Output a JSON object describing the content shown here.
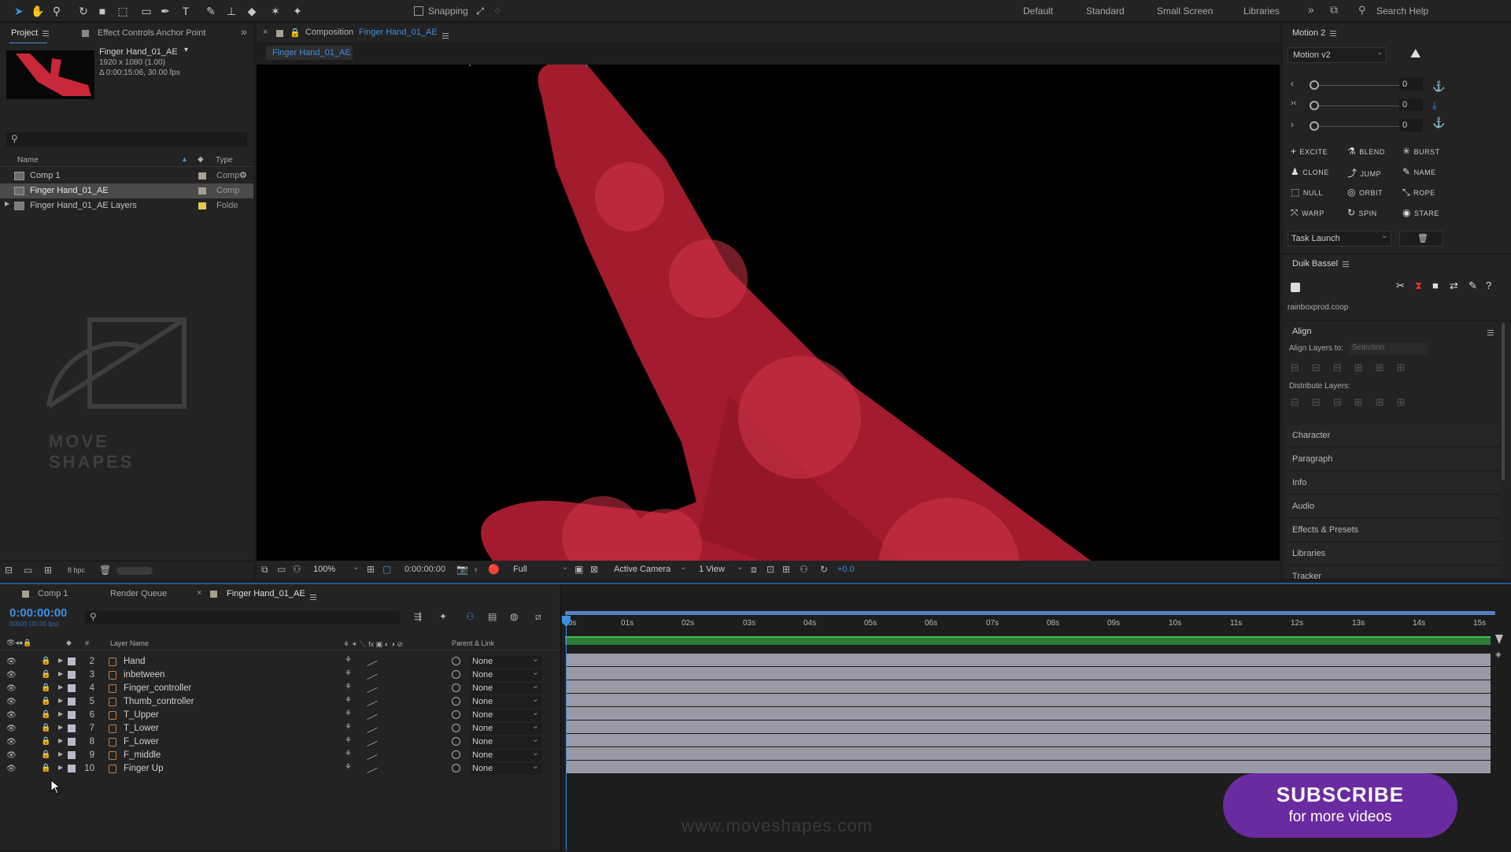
{
  "toolbar": {
    "snapping_label": "Snapping",
    "workspaces": [
      "Default",
      "Standard",
      "Small Screen",
      "Libraries"
    ],
    "search_placeholder": "Search Help"
  },
  "project_panel": {
    "tabs": [
      "Project",
      "Effect Controls Anchor Point"
    ],
    "comp_name": "Finger Hand_01_AE",
    "comp_size": "1920 x 1080 (1.00)",
    "comp_duration": "Δ 0:00:15:06, 30.00 fps",
    "col_name": "Name",
    "col_type": "Type",
    "items": [
      {
        "name": "Comp 1",
        "type": "Comp",
        "tag_color": "#a8a090"
      },
      {
        "name": "Finger Hand_01_AE",
        "type": "Comp",
        "tag_color": "#a8a090"
      },
      {
        "name": "Finger Hand_01_AE Layers",
        "type": "Folde",
        "tag_color": "#e6c850"
      }
    ],
    "watermark_text": "MOVE SHAPES",
    "bpc": "8 bpc"
  },
  "composition_panel": {
    "tab_prefix": "Composition",
    "tab_name": "Finger Hand_01_AE",
    "breadcrumb": "Finger Hand_01_AE",
    "zoom": "100%",
    "timecode": "0:00:00:00",
    "resolution": "Full",
    "camera": "Active Camera",
    "view": "1 View",
    "exposure": "+0.0"
  },
  "motion_panel": {
    "title": "Motion 2",
    "preset": "Motion v2",
    "slider_values": [
      "0",
      "0",
      "0"
    ],
    "buttons": [
      {
        "label": "EXCITE",
        "icon": "+"
      },
      {
        "label": "BLEND",
        "icon": "⚗"
      },
      {
        "label": "BURST",
        "icon": "✳"
      },
      {
        "label": "CLONE",
        "icon": "♟"
      },
      {
        "label": "JUMP",
        "icon": "⤴"
      },
      {
        "label": "NAME",
        "icon": "✎"
      },
      {
        "label": "NULL",
        "icon": "⬚"
      },
      {
        "label": "ORBIT",
        "icon": "◎"
      },
      {
        "label": "ROPE",
        "icon": "⤡"
      },
      {
        "label": "WARP",
        "icon": "⤧"
      },
      {
        "label": "SPIN",
        "icon": "↻"
      },
      {
        "label": "STARE",
        "icon": "◉"
      }
    ],
    "task": "Task Launch"
  },
  "duik_panel": {
    "title": "Duik Bassel",
    "credit": "rainboxprod.coop"
  },
  "align_panel": {
    "title": "Align",
    "align_to_label": "Align Layers to:",
    "align_to_value": "Selection",
    "distribute_label": "Distribute Layers:"
  },
  "side_panels": [
    "Character",
    "Paragraph",
    "Info",
    "Audio",
    "Effects & Presets",
    "Libraries",
    "Tracker"
  ],
  "timeline": {
    "tabs": [
      "Comp 1",
      "Render Queue",
      "Finger Hand_01_AE"
    ],
    "timecode": "0:00:00:00",
    "timecode_sub": "00000 (30.00 fps)",
    "col_layer_name": "Layer Name",
    "col_parent": "Parent & Link",
    "ruler": [
      "0s",
      "01s",
      "02s",
      "03s",
      "04s",
      "05s",
      "06s",
      "07s",
      "08s",
      "09s",
      "10s",
      "11s",
      "12s",
      "13s",
      "14s",
      "15s"
    ],
    "layers": [
      {
        "num": "2",
        "name": "Hand",
        "parent": "None"
      },
      {
        "num": "3",
        "name": "inbetween",
        "parent": "None"
      },
      {
        "num": "4",
        "name": "Finger_controller",
        "parent": "None"
      },
      {
        "num": "5",
        "name": "Thumb_controller",
        "parent": "None"
      },
      {
        "num": "6",
        "name": "T_Upper",
        "parent": "None"
      },
      {
        "num": "7",
        "name": "T_Lower",
        "parent": "None"
      },
      {
        "num": "8",
        "name": "F_Lower",
        "parent": "None"
      },
      {
        "num": "9",
        "name": "F_middle",
        "parent": "None"
      },
      {
        "num": "10",
        "name": "Finger Up",
        "parent": "None"
      }
    ]
  },
  "overlay": {
    "website": "www.moveshapes.com",
    "subscribe_title": "SUBSCRIBE",
    "subscribe_sub": "for more videos"
  },
  "colors": {
    "accent": "#2d8ceb",
    "timecode": "#3c8fe0",
    "shape_red": "#c8283a",
    "subscribe_bg": "#6a2aa0"
  }
}
